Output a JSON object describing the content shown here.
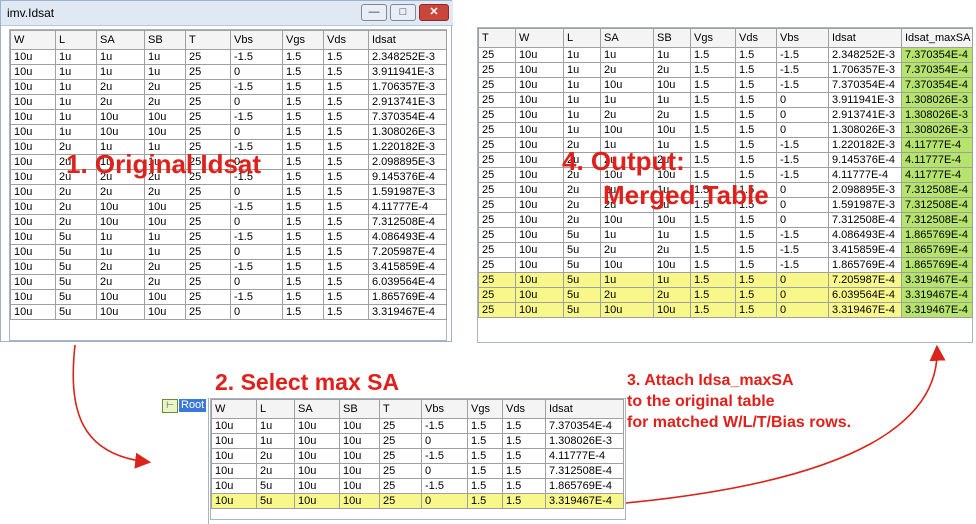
{
  "window": {
    "title": "imv.Idsat",
    "minimize": "—",
    "maximize": "□",
    "close": "✕"
  },
  "labels": {
    "step1": "1. Original Idsat",
    "step2": "2. Select max SA",
    "step3_l1": "3. Attach Idsa_maxSA",
    "step3_l2": "to the original table",
    "step3_l3": "for matched W/L/T/Bias rows.",
    "step4_l1": "4. Output:",
    "step4_l2": "Merged Table"
  },
  "tree": {
    "root": "Root"
  },
  "original": {
    "headers": [
      "W",
      "L",
      "SA",
      "SB",
      "T",
      "Vbs",
      "Vgs",
      "Vds",
      "Idsat"
    ],
    "rows": [
      [
        "10u",
        "1u",
        "1u",
        "1u",
        "25",
        "-1.5",
        "1.5",
        "1.5",
        "2.348252E-3"
      ],
      [
        "10u",
        "1u",
        "1u",
        "1u",
        "25",
        "0",
        "1.5",
        "1.5",
        "3.911941E-3"
      ],
      [
        "10u",
        "1u",
        "2u",
        "2u",
        "25",
        "-1.5",
        "1.5",
        "1.5",
        "1.706357E-3"
      ],
      [
        "10u",
        "1u",
        "2u",
        "2u",
        "25",
        "0",
        "1.5",
        "1.5",
        "2.913741E-3"
      ],
      [
        "10u",
        "1u",
        "10u",
        "10u",
        "25",
        "-1.5",
        "1.5",
        "1.5",
        "7.370354E-4"
      ],
      [
        "10u",
        "1u",
        "10u",
        "10u",
        "25",
        "0",
        "1.5",
        "1.5",
        "1.308026E-3"
      ],
      [
        "10u",
        "2u",
        "1u",
        "1u",
        "25",
        "-1.5",
        "1.5",
        "1.5",
        "1.220182E-3"
      ],
      [
        "10u",
        "2u",
        "1u",
        "1u",
        "25",
        "0",
        "1.5",
        "1.5",
        "2.098895E-3"
      ],
      [
        "10u",
        "2u",
        "2u",
        "2u",
        "25",
        "-1.5",
        "1.5",
        "1.5",
        "9.145376E-4"
      ],
      [
        "10u",
        "2u",
        "2u",
        "2u",
        "25",
        "0",
        "1.5",
        "1.5",
        "1.591987E-3"
      ],
      [
        "10u",
        "2u",
        "10u",
        "10u",
        "25",
        "-1.5",
        "1.5",
        "1.5",
        "4.11777E-4"
      ],
      [
        "10u",
        "2u",
        "10u",
        "10u",
        "25",
        "0",
        "1.5",
        "1.5",
        "7.312508E-4"
      ],
      [
        "10u",
        "5u",
        "1u",
        "1u",
        "25",
        "-1.5",
        "1.5",
        "1.5",
        "4.086493E-4"
      ],
      [
        "10u",
        "5u",
        "1u",
        "1u",
        "25",
        "0",
        "1.5",
        "1.5",
        "7.205987E-4"
      ],
      [
        "10u",
        "5u",
        "2u",
        "2u",
        "25",
        "-1.5",
        "1.5",
        "1.5",
        "3.415859E-4"
      ],
      [
        "10u",
        "5u",
        "2u",
        "2u",
        "25",
        "0",
        "1.5",
        "1.5",
        "6.039564E-4"
      ],
      [
        "10u",
        "5u",
        "10u",
        "10u",
        "25",
        "-1.5",
        "1.5",
        "1.5",
        "1.865769E-4"
      ],
      [
        "10u",
        "5u",
        "10u",
        "10u",
        "25",
        "0",
        "1.5",
        "1.5",
        "3.319467E-4"
      ]
    ]
  },
  "maxsa": {
    "headers": [
      "W",
      "L",
      "SA",
      "SB",
      "T",
      "Vbs",
      "Vgs",
      "Vds",
      "Idsat"
    ],
    "rows": [
      [
        "10u",
        "1u",
        "10u",
        "10u",
        "25",
        "-1.5",
        "1.5",
        "1.5",
        "7.370354E-4"
      ],
      [
        "10u",
        "1u",
        "10u",
        "10u",
        "25",
        "0",
        "1.5",
        "1.5",
        "1.308026E-3"
      ],
      [
        "10u",
        "2u",
        "10u",
        "10u",
        "25",
        "-1.5",
        "1.5",
        "1.5",
        "4.11777E-4"
      ],
      [
        "10u",
        "2u",
        "10u",
        "10u",
        "25",
        "0",
        "1.5",
        "1.5",
        "7.312508E-4"
      ],
      [
        "10u",
        "5u",
        "10u",
        "10u",
        "25",
        "-1.5",
        "1.5",
        "1.5",
        "1.865769E-4"
      ],
      [
        "10u",
        "5u",
        "10u",
        "10u",
        "25",
        "0",
        "1.5",
        "1.5",
        "3.319467E-4"
      ]
    ],
    "highlight_row": 5
  },
  "merged": {
    "headers": [
      "T",
      "W",
      "L",
      "SA",
      "SB",
      "Vgs",
      "Vds",
      "Vbs",
      "Idsat",
      "Idsat_maxSA"
    ],
    "rows": [
      [
        "25",
        "10u",
        "1u",
        "1u",
        "1u",
        "1.5",
        "1.5",
        "-1.5",
        "2.348252E-3",
        "7.370354E-4"
      ],
      [
        "25",
        "10u",
        "1u",
        "2u",
        "2u",
        "1.5",
        "1.5",
        "-1.5",
        "1.706357E-3",
        "7.370354E-4"
      ],
      [
        "25",
        "10u",
        "1u",
        "10u",
        "10u",
        "1.5",
        "1.5",
        "-1.5",
        "7.370354E-4",
        "7.370354E-4"
      ],
      [
        "25",
        "10u",
        "1u",
        "1u",
        "1u",
        "1.5",
        "1.5",
        "0",
        "3.911941E-3",
        "1.308026E-3"
      ],
      [
        "25",
        "10u",
        "1u",
        "2u",
        "2u",
        "1.5",
        "1.5",
        "0",
        "2.913741E-3",
        "1.308026E-3"
      ],
      [
        "25",
        "10u",
        "1u",
        "10u",
        "10u",
        "1.5",
        "1.5",
        "0",
        "1.308026E-3",
        "1.308026E-3"
      ],
      [
        "25",
        "10u",
        "2u",
        "1u",
        "1u",
        "1.5",
        "1.5",
        "-1.5",
        "1.220182E-3",
        "4.11777E-4"
      ],
      [
        "25",
        "10u",
        "2u",
        "2u",
        "2u",
        "1.5",
        "1.5",
        "-1.5",
        "9.145376E-4",
        "4.11777E-4"
      ],
      [
        "25",
        "10u",
        "2u",
        "10u",
        "10u",
        "1.5",
        "1.5",
        "-1.5",
        "4.11777E-4",
        "4.11777E-4"
      ],
      [
        "25",
        "10u",
        "2u",
        "1u",
        "1u",
        "1.5",
        "1.5",
        "0",
        "2.098895E-3",
        "7.312508E-4"
      ],
      [
        "25",
        "10u",
        "2u",
        "2u",
        "2u",
        "1.5",
        "1.5",
        "0",
        "1.591987E-3",
        "7.312508E-4"
      ],
      [
        "25",
        "10u",
        "2u",
        "10u",
        "10u",
        "1.5",
        "1.5",
        "0",
        "7.312508E-4",
        "7.312508E-4"
      ],
      [
        "25",
        "10u",
        "5u",
        "1u",
        "1u",
        "1.5",
        "1.5",
        "-1.5",
        "4.086493E-4",
        "1.865769E-4"
      ],
      [
        "25",
        "10u",
        "5u",
        "2u",
        "2u",
        "1.5",
        "1.5",
        "-1.5",
        "3.415859E-4",
        "1.865769E-4"
      ],
      [
        "25",
        "10u",
        "5u",
        "10u",
        "10u",
        "1.5",
        "1.5",
        "-1.5",
        "1.865769E-4",
        "1.865769E-4"
      ],
      [
        "25",
        "10u",
        "5u",
        "1u",
        "1u",
        "1.5",
        "1.5",
        "0",
        "7.205987E-4",
        "3.319467E-4"
      ],
      [
        "25",
        "10u",
        "5u",
        "2u",
        "2u",
        "1.5",
        "1.5",
        "0",
        "6.039564E-4",
        "3.319467E-4"
      ],
      [
        "25",
        "10u",
        "5u",
        "10u",
        "10u",
        "1.5",
        "1.5",
        "0",
        "3.319467E-4",
        "3.319467E-4"
      ]
    ],
    "highlight_rows": [
      15,
      16,
      17
    ]
  },
  "colors": {
    "label_red": "#e0201a",
    "row_yellow": "#f7f78a",
    "col_green": "#b5e36c",
    "arrow_red": "#d9241b"
  }
}
